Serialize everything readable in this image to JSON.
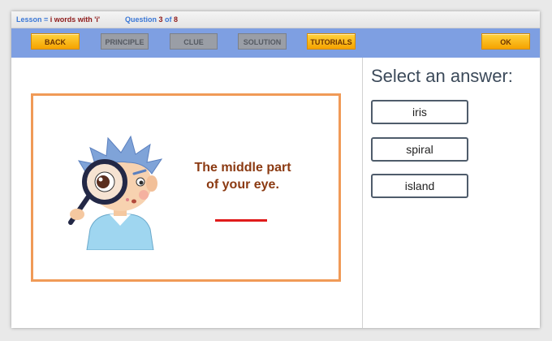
{
  "lesson_bar": {
    "lesson_label": "Lesson = ",
    "lesson_name": "i words with 'i'",
    "question_label": "Question ",
    "question_number": "3",
    "of_label": " of ",
    "question_total": "8"
  },
  "toolbar": {
    "back": "BACK",
    "principle": "PRINCIPLE",
    "clue": "CLUE",
    "solution": "SOLUTION",
    "tutorials": "TUTORIALS",
    "ok": "OK"
  },
  "question": {
    "clue_line1": "The middle part",
    "clue_line2": "of your eye."
  },
  "answers": {
    "title": "Select an answer:",
    "options": [
      "iris",
      "spiral",
      "island"
    ]
  },
  "colors": {
    "accent_orange": "#f09a57",
    "toolbar_blue": "#7e9fe2",
    "clue_brown": "#8b3a12",
    "blank_red": "#e01b1b"
  },
  "icons": {
    "illustration": "boy-with-magnifying-glass"
  }
}
